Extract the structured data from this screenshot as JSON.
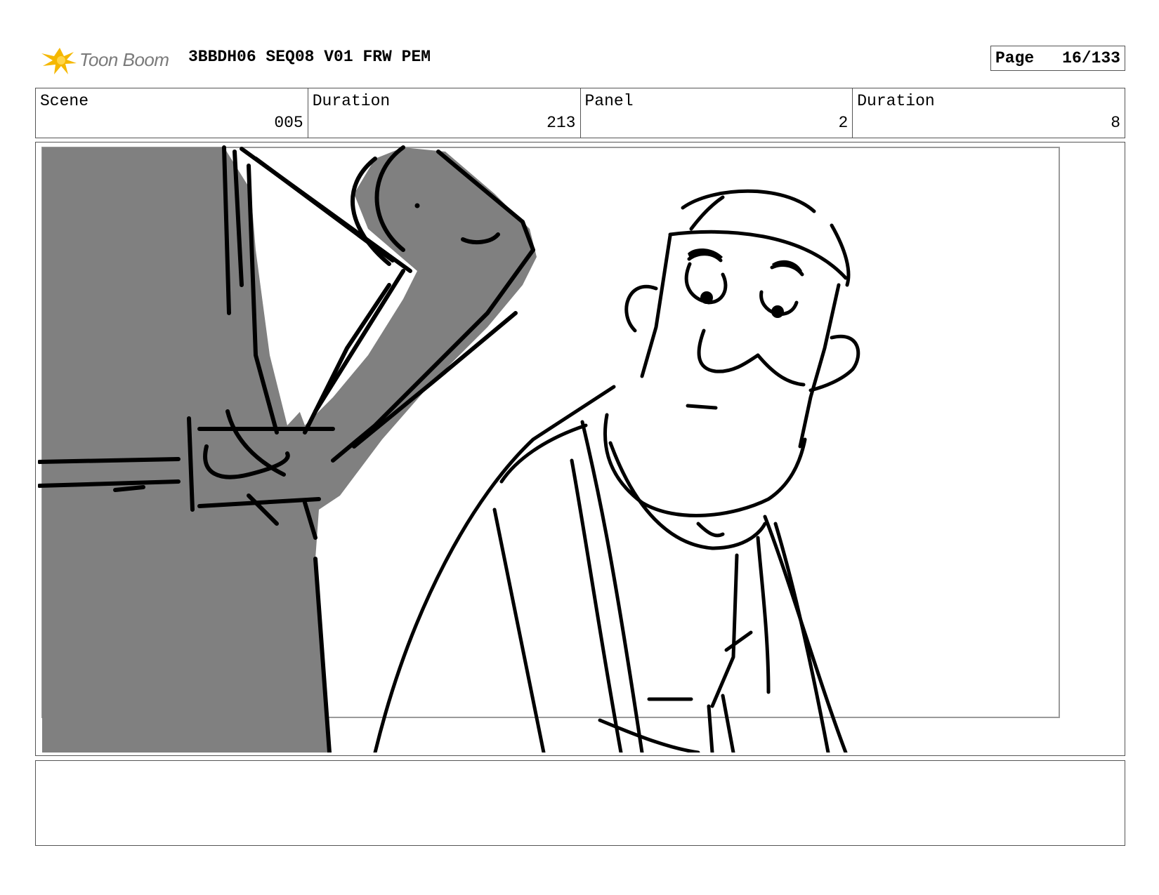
{
  "header": {
    "logo_text": "Toon Boom",
    "doc_title": "3BBDH06 SEQ08 V01 FRW PEM",
    "page_label": "Page",
    "page_value": "16/133"
  },
  "info": {
    "scene_label": "Scene",
    "scene_value": "005",
    "scene_duration_label": "Duration",
    "scene_duration_value": "213",
    "panel_label": "Panel",
    "panel_value": "2",
    "panel_duration_label": "Duration",
    "panel_duration_value": "8"
  },
  "notes": {
    "text": ""
  },
  "colors": {
    "logo_star": "#f5b800",
    "sketch_gray": "#808080",
    "border": "#555555"
  }
}
